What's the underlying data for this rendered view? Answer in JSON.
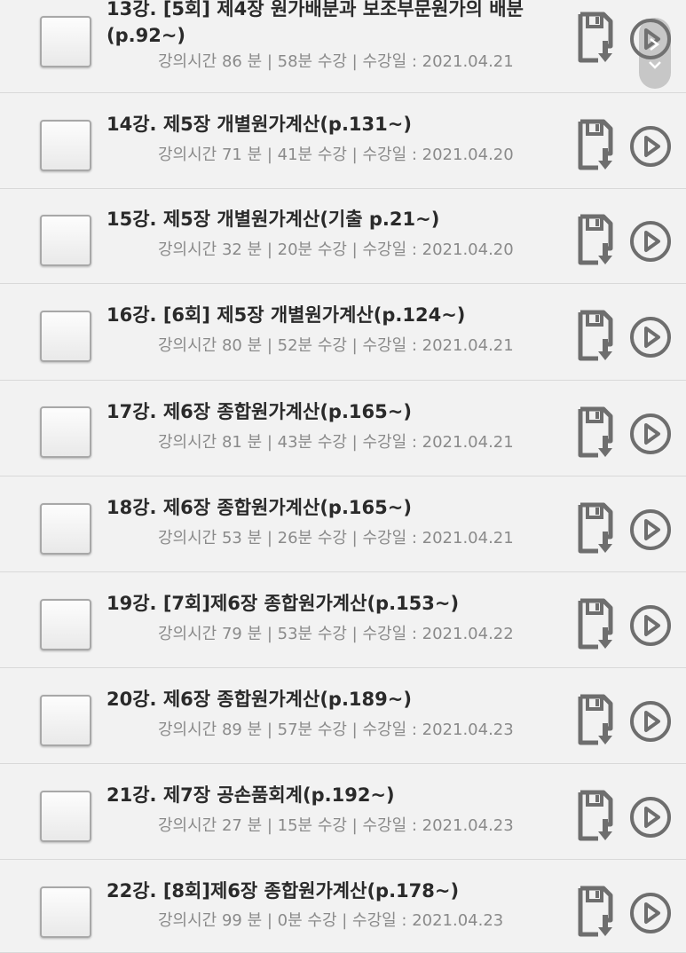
{
  "lectures": [
    {
      "title": "13강. [5회] 제4장 원가배분과 보조부문원가의 배분(p.92~)",
      "meta": "강의시간 86 분 | 58분 수강 | 수강일 : 2021.04.21"
    },
    {
      "title": "14강. 제5장 개별원가계산(p.131~)",
      "meta": "강의시간 71 분 | 41분 수강 | 수강일 : 2021.04.20"
    },
    {
      "title": "15강. 제5장 개별원가계산(기출 p.21~)",
      "meta": "강의시간 32 분 | 20분 수강 | 수강일 : 2021.04.20"
    },
    {
      "title": "16강. [6회] 제5장 개별원가계산(p.124~)",
      "meta": "강의시간 80 분 | 52분 수강 | 수강일 : 2021.04.21"
    },
    {
      "title": "17강. 제6장 종합원가계산(p.165~)",
      "meta": "강의시간 81 분 | 43분 수강 | 수강일 : 2021.04.21"
    },
    {
      "title": "18강. 제6장 종합원가계산(p.165~)",
      "meta": "강의시간 53 분 | 26분 수강 | 수강일 : 2021.04.21"
    },
    {
      "title": "19강. [7회]제6장 종합원가계산(p.153~)",
      "meta": "강의시간 79 분 | 53분 수강 | 수강일 : 2021.04.22"
    },
    {
      "title": "20강. 제6장 종합원가계산(p.189~)",
      "meta": "강의시간 89 분 | 57분 수강 | 수강일 : 2021.04.23"
    },
    {
      "title": "21강. 제7장 공손품회계(p.192~)",
      "meta": "강의시간 27 분 | 15분 수강 | 수강일 : 2021.04.23"
    },
    {
      "title": "22강. [8회]제6장 종합원가계산(p.178~)",
      "meta": "강의시간 99 분 | 0분 수강 | 수강일 : 2021.04.23"
    }
  ],
  "icons": {
    "download": "download-icon",
    "play": "play-icon",
    "checkbox": "checkbox"
  },
  "colors": {
    "background": "#f2f2f2",
    "title": "#2a2a2a",
    "meta": "#8a8a8a",
    "icon": "#6e6e6e"
  }
}
